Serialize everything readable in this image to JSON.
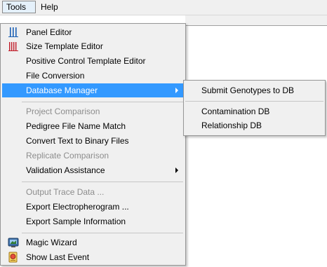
{
  "menubar": {
    "tools": "Tools",
    "help": "Help"
  },
  "tools_menu": {
    "panel_editor": "Panel Editor",
    "size_template_editor": "Size Template Editor",
    "positive_control_template_editor": "Positive Control Template Editor",
    "file_conversion": "File Conversion",
    "database_manager": "Database Manager",
    "project_comparison": "Project Comparison",
    "pedigree_file_name_match": "Pedigree File Name Match",
    "convert_text_to_binary_files": "Convert Text to Binary Files",
    "replicate_comparison": "Replicate Comparison",
    "validation_assistance": "Validation Assistance",
    "output_trace_data": "Output Trace Data ...",
    "export_electropherogram": "Export Electropherogram ...",
    "export_sample_information": "Export Sample Information",
    "magic_wizard": "Magic Wizard",
    "show_last_event": "Show Last Event"
  },
  "database_submenu": {
    "submit_genotypes": "Submit Genotypes to DB",
    "contamination_db": "Contamination DB",
    "relationship_db": "Relationship DB"
  },
  "colors": {
    "highlight": "#3399ff",
    "menu_bg": "#f0f0f0",
    "disabled_text": "#8d8d8d"
  },
  "icons": {
    "panel_editor": "panel-editor-icon",
    "size_template_editor": "size-template-icon",
    "magic_wizard": "magic-wizard-icon",
    "show_last_event": "show-last-event-icon"
  }
}
